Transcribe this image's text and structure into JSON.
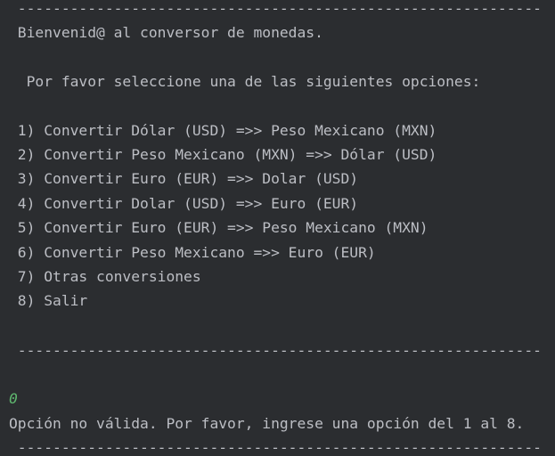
{
  "console": {
    "separator": " ------------------------------------------------------------",
    "welcome": " Bienvenid@ al conversor de monedas.",
    "prompt": "  Por favor seleccione una de las siguientes opciones:",
    "menu_items": [
      " 1) Convertir Dólar (USD) =>> Peso Mexicano (MXN)",
      " 2) Convertir Peso Mexicano (MXN) =>> Dólar (USD)",
      " 3) Convertir Euro (EUR) =>> Dolar (USD)",
      " 4) Convertir Dolar (USD) =>> Euro (EUR)",
      " 5) Convertir Euro (EUR) =>> Peso Mexicano (MXN)",
      " 6) Convertir Peso Mexicano =>> Euro (EUR)",
      " 7) Otras conversiones",
      " 8) Salir"
    ],
    "user_input": "0",
    "error_message": "Opción no válida. Por favor, ingrese una opción del 1 al 8.",
    "colors": {
      "background": "#2b2d30",
      "text": "#bcbec4",
      "user_input": "#5fb86f"
    }
  }
}
